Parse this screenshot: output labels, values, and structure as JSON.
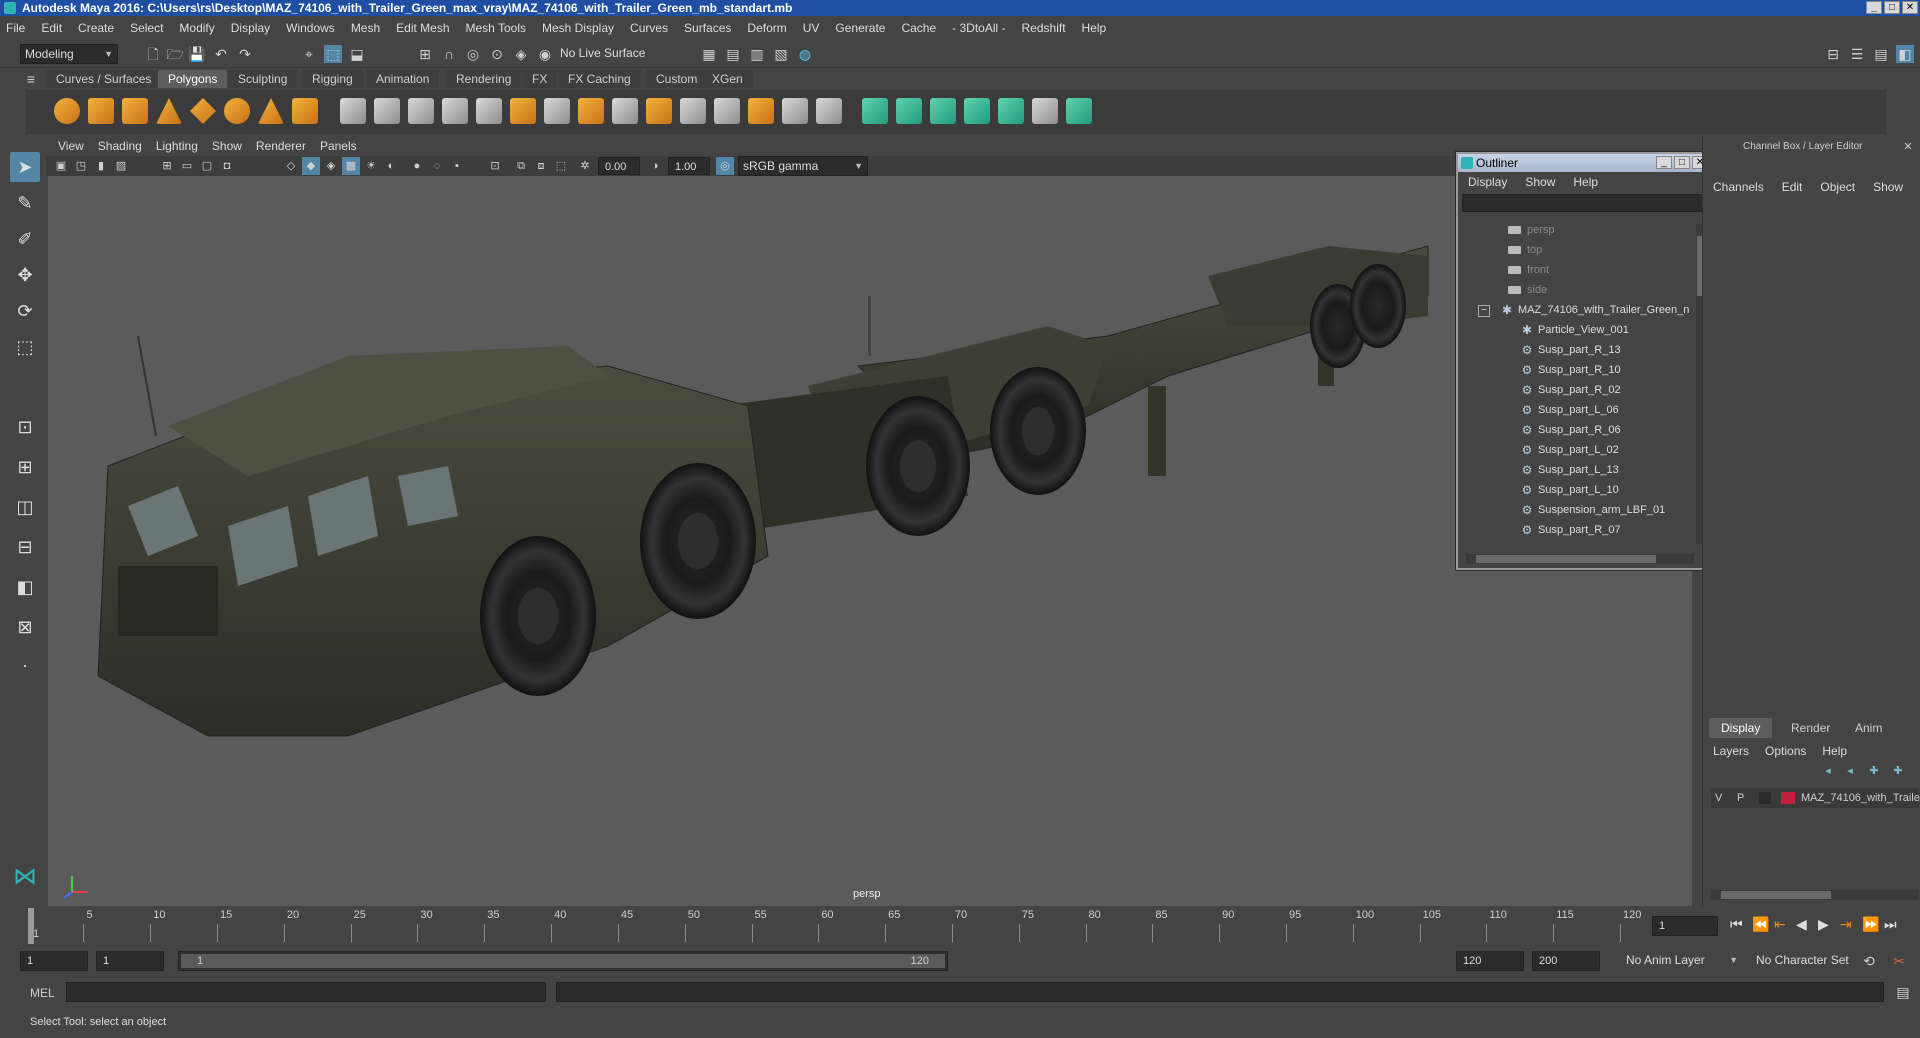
{
  "window": {
    "title": "Autodesk Maya 2016: C:\\Users\\rs\\Desktop\\MAZ_74106_with_Trailer_Green_max_vray\\MAZ_74106_with_Trailer_Green_mb_standart.mb",
    "controls": [
      "_",
      "□",
      "✕"
    ]
  },
  "menubar": [
    "File",
    "Edit",
    "Create",
    "Select",
    "Modify",
    "Display",
    "Windows",
    "Mesh",
    "Edit Mesh",
    "Mesh Tools",
    "Mesh Display",
    "Curves",
    "Surfaces",
    "Deform",
    "UV",
    "Generate",
    "Cache",
    "- 3DtoAll -",
    "Redshift",
    "Help"
  ],
  "statusline": {
    "mode": "Modeling",
    "live_surface": "No Live Surface"
  },
  "shelf_tabs": [
    "Curves / Surfaces",
    "Polygons",
    "Sculpting",
    "Rigging",
    "Animation",
    "Rendering",
    "FX",
    "FX Caching",
    "Custom",
    "XGen"
  ],
  "shelf_active_tab": "Polygons",
  "viewport": {
    "menu": [
      "View",
      "Shading",
      "Lighting",
      "Show",
      "Renderer",
      "Panels"
    ],
    "exposure": "0.00",
    "gamma": "1.00",
    "color_space": "sRGB gamma",
    "camera_label": "persp"
  },
  "outliner": {
    "title": "Outliner",
    "menu": [
      "Display",
      "Show",
      "Help"
    ],
    "items": [
      {
        "label": "persp",
        "type": "camera"
      },
      {
        "label": "top",
        "type": "camera"
      },
      {
        "label": "front",
        "type": "camera"
      },
      {
        "label": "side",
        "type": "camera"
      },
      {
        "label": "MAZ_74106_with_Trailer_Green_n",
        "type": "group"
      },
      {
        "label": "Particle_View_001",
        "type": "node"
      },
      {
        "label": "Susp_part_R_13",
        "type": "mesh"
      },
      {
        "label": "Susp_part_R_10",
        "type": "mesh"
      },
      {
        "label": "Susp_part_R_02",
        "type": "mesh"
      },
      {
        "label": "Susp_part_L_06",
        "type": "mesh"
      },
      {
        "label": "Susp_part_R_06",
        "type": "mesh"
      },
      {
        "label": "Susp_part_L_02",
        "type": "mesh"
      },
      {
        "label": "Susp_part_L_13",
        "type": "mesh"
      },
      {
        "label": "Susp_part_L_10",
        "type": "mesh"
      },
      {
        "label": "Suspension_arm_LBF_01",
        "type": "mesh"
      },
      {
        "label": "Susp_part_R_07",
        "type": "mesh"
      }
    ]
  },
  "channelbox": {
    "title": "Channel Box / Layer Editor",
    "menu": [
      "Channels",
      "Edit",
      "Object",
      "Show"
    ]
  },
  "layers": {
    "tabs": [
      "Display",
      "Render",
      "Anim"
    ],
    "active_tab": "Display",
    "menu": [
      "Layers",
      "Options",
      "Help"
    ],
    "row": {
      "v": "V",
      "p": "P",
      "name": "MAZ_74106_with_Traile",
      "color": "#c0203a"
    }
  },
  "timeline": {
    "ticks": [
      "1",
      "5",
      "10",
      "15",
      "20",
      "25",
      "30",
      "35",
      "40",
      "45",
      "50",
      "55",
      "60",
      "65",
      "70",
      "75",
      "80",
      "85",
      "90",
      "95",
      "100",
      "105",
      "110",
      "115",
      "120"
    ],
    "current_frame": "1"
  },
  "range": {
    "start": "1",
    "playback_start": "1",
    "slider_start": "1",
    "slider_end": "120",
    "playback_end": "120",
    "end": "200",
    "anim_layer": "No Anim Layer",
    "character_set": "No Character Set"
  },
  "cmdline": {
    "label": "MEL"
  },
  "helpline": "Select Tool: select an object"
}
